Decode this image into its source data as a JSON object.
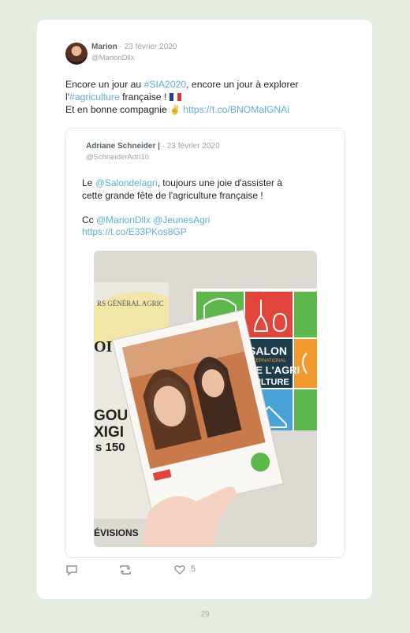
{
  "tweet": {
    "author_name": "Marion",
    "separator": " · ",
    "date": "23 février 2020",
    "handle": "@MarionDllx",
    "text_1": "Encore un jour au ",
    "hashtag_sia": "#SIA2020",
    "text_2": ", encore un jour à explorer",
    "text_3": "l'",
    "hashtag_agri": "#agriculture",
    "text_4": " française ! ",
    "text_5": "Et en bonne compagnie ",
    "hand_emoji": "✌",
    "link": "https://t.co/BNOMalGNAi"
  },
  "quoted": {
    "author_name": "Adriane Schneider |",
    "separator": " · ",
    "date": "23 février 2020",
    "handle": "@SchneiderAdri10",
    "text_1": "Le ",
    "mention_salon": "@Salondelagri",
    "text_2": ", toujours une joie d'assister à",
    "text_3": "cette grande fête de l'agriculture française !",
    "text_cc": "Cc ",
    "mention_marion": "@MarionDllx",
    "mention_jeunes": "@JeunesAgri",
    "link": "https://t.co/E33PKos8GP"
  },
  "photo": {
    "sign_line_1": "SALON",
    "sign_line_2": "INTERNATIONAL",
    "sign_line_3": "DE L'AGRI",
    "sign_line_4": "CULTURE",
    "left_frag_1": "OI",
    "left_frag_2": "GOU",
    "left_frag_3": "XIGI",
    "left_frag_4": "s 150",
    "bottom_frag": "ÉVISIONS",
    "top_frag": "RS GÉNÉRAL AGRIC"
  },
  "actions": {
    "likes": "5"
  },
  "page_number": "29",
  "colors": {
    "link": "#5aaee0",
    "background": "#e4ebe1"
  }
}
